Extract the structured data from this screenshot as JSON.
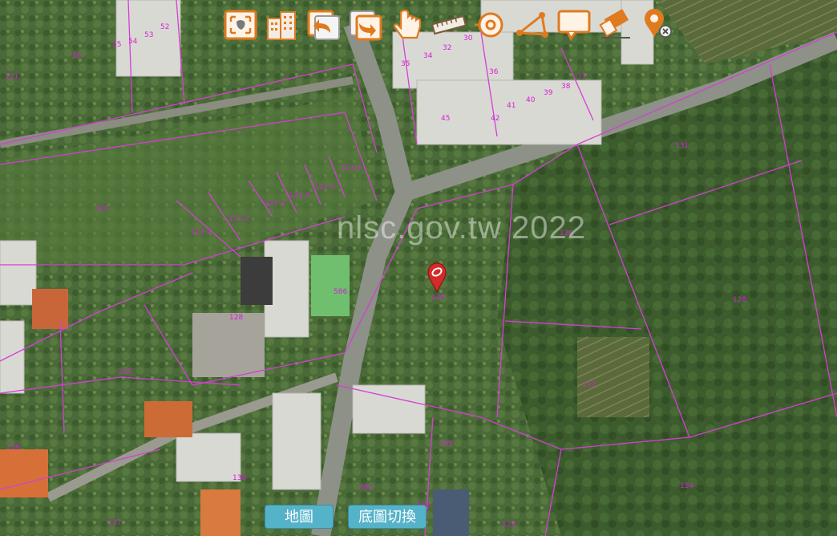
{
  "watermark": "nlsc.gov.tw 2022",
  "toolbar": {
    "icons": [
      "fullscreen-icon",
      "buildings-3d-icon",
      "undo-view-icon",
      "redo-view-icon",
      "pan-hand-icon",
      "measure-distance-icon",
      "measure-radius-icon",
      "measure-polyline-icon",
      "annotation-icon",
      "eraser-icon",
      "clear-marker-icon"
    ]
  },
  "buttons": {
    "map": "地圖",
    "basemap_switch": "底圖切換"
  },
  "parcels": [
    "52",
    "53",
    "54",
    "55",
    "56",
    "35",
    "34",
    "32",
    "30",
    "36",
    "37",
    "38",
    "39",
    "40",
    "41",
    "42",
    "45",
    "121-1",
    "121-2",
    "121-3",
    "121-4",
    "121-5",
    "121-6",
    "124",
    "128",
    "128",
    "586",
    "129",
    "130",
    "131",
    "132",
    "133",
    "134",
    "135",
    "136",
    "137",
    "138",
    "582",
    "583",
    "129",
    "121"
  ],
  "colors": {
    "parcel_line": "#d43fd4",
    "button": "#55b3c9",
    "tool_orange": "#e07a1f",
    "marker": "#d42a2a"
  }
}
